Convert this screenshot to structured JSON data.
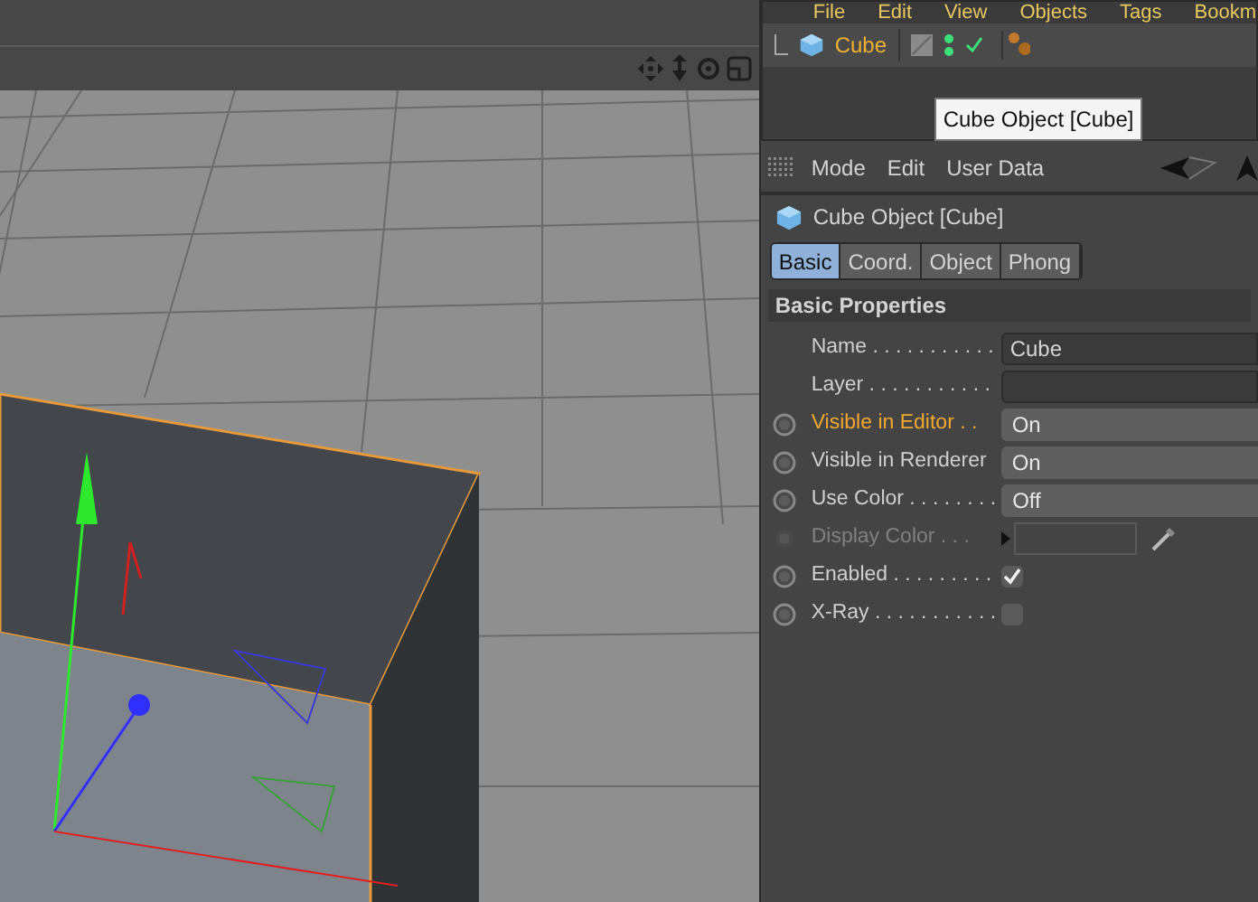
{
  "object_manager": {
    "menu": [
      "File",
      "Edit",
      "View",
      "Objects",
      "Tags",
      "Bookm"
    ],
    "objects": [
      {
        "name": "Cube",
        "selected": true
      }
    ],
    "tooltip": "Cube Object [Cube]"
  },
  "attribute_manager": {
    "menu": [
      "Mode",
      "Edit",
      "User Data"
    ],
    "title": "Cube Object [Cube]",
    "tabs": [
      {
        "label": "Basic",
        "selected": true
      },
      {
        "label": "Coord.",
        "selected": false
      },
      {
        "label": "Object",
        "selected": false
      },
      {
        "label": "Phong",
        "selected": false
      }
    ],
    "section": "Basic Properties",
    "properties": [
      {
        "kind": "text",
        "label": "Name . . . . . . . . . . .",
        "value": "Cube",
        "keyframe": false,
        "highlighted": false,
        "disabled": false
      },
      {
        "kind": "text",
        "label": "Layer . . . . . . . . . . .",
        "keyframe": false,
        "highlighted": false,
        "disabled": false
      },
      {
        "kind": "dropdown",
        "label": "Visible in Editor . .",
        "value": "On",
        "keyframe": true,
        "highlighted": true,
        "disabled": false
      },
      {
        "kind": "dropdown",
        "label": "Visible in Renderer",
        "value": "On",
        "keyframe": true,
        "highlighted": false,
        "disabled": false
      },
      {
        "kind": "dropdown",
        "label": "Use Color . . . . . . . .",
        "value": "Off",
        "keyframe": true,
        "highlighted": false,
        "disabled": false
      },
      {
        "kind": "color",
        "label": "Display Color . . .",
        "keyframe": true,
        "highlighted": false,
        "disabled": true
      },
      {
        "kind": "checkbox",
        "label": "Enabled . . . . . . . . .",
        "checked": true,
        "keyframe": true,
        "highlighted": false,
        "disabled": false
      },
      {
        "kind": "checkbox",
        "label": "X-Ray . . . . . . . . . . .",
        "checked": false,
        "keyframe": true,
        "highlighted": false,
        "disabled": false
      }
    ]
  }
}
